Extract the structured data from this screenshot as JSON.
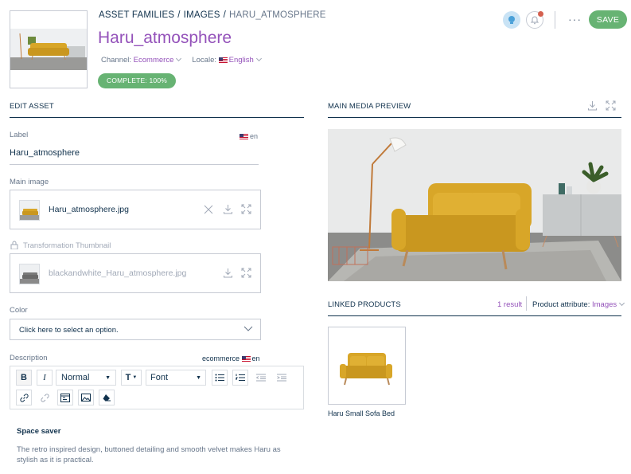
{
  "header": {
    "breadcrumb": [
      "ASSET FAMILIES",
      "IMAGES",
      "HARU_ATMOSPHERE"
    ],
    "breadcrumb_sep": "/",
    "title": "Haru_atmosphere",
    "channel_label": "Channel:",
    "channel_value": "Ecommerce",
    "locale_label": "Locale:",
    "locale_value": "English",
    "completeness": "COMPLETE: 100%",
    "more_label": "···",
    "save_label": "SAVE"
  },
  "edit": {
    "section_title": "EDIT ASSET",
    "label_field": {
      "label": "Label",
      "locale": "en",
      "value": "Haru_atmosphere"
    },
    "main_image": {
      "label": "Main image",
      "file": "Haru_atmosphere.jpg"
    },
    "transformation": {
      "label": "Transformation Thumbnail",
      "file": "blackandwhite_Haru_atmosphere.jpg"
    },
    "color": {
      "label": "Color",
      "placeholder": "Click here to select an option."
    },
    "description": {
      "label": "Description",
      "scope": "ecommerce",
      "locale": "en",
      "toolbar": {
        "bold": "B",
        "italic": "I",
        "block_type": "Normal",
        "text_size": "T",
        "font": "Font"
      },
      "heading": "Space saver",
      "body": "The retro inspired design, buttoned detailing and smooth velvet makes Haru as stylish as it is practical."
    }
  },
  "preview": {
    "section_title": "MAIN MEDIA PREVIEW"
  },
  "linked": {
    "section_title": "LINKED PRODUCTS",
    "count": "1 result",
    "attribute_label": "Product attribute:",
    "attribute_value": "Images",
    "products": [
      {
        "name": "Haru Small Sofa Bed"
      }
    ]
  },
  "colors": {
    "accent": "#9452ba",
    "success": "#67b373",
    "text": "#11324d",
    "muted": "#67768a",
    "border": "#c7cbd4",
    "sofa": "#d8a628"
  },
  "icons": [
    "help-icon",
    "bell-icon",
    "remove-icon",
    "download-icon",
    "fullscreen-icon",
    "lock-icon",
    "chevron-down-icon",
    "bullet-list-icon",
    "numbered-list-icon",
    "outdent-icon",
    "indent-icon",
    "link-icon",
    "unlink-icon",
    "embed-icon",
    "image-icon",
    "eraser-icon"
  ]
}
